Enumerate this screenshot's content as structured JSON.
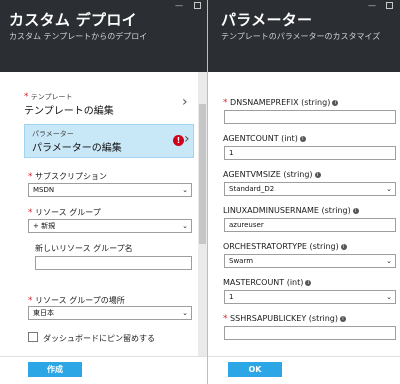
{
  "left_blade": {
    "title": "カスタム デプロイ",
    "subtitle": "カスタム テンプレートからのデプロイ",
    "template": {
      "required_mark": "*",
      "label": "テンプレート",
      "value": "テンプレートの編集"
    },
    "parameters": {
      "label": "パラメーター",
      "value": "パラメーターの編集",
      "error_icon": "!"
    },
    "subscription": {
      "required_mark": "*",
      "label": "サブスクリプション",
      "value": "MSDN"
    },
    "resource_group": {
      "required_mark": "*",
      "label": "リソース グループ",
      "value": "+ 新規"
    },
    "new_resource_group": {
      "label": "新しいリソース グループ名",
      "value": ""
    },
    "resource_group_location": {
      "required_mark": "*",
      "label": "リソース グループの場所",
      "value": "東日本"
    },
    "pin_to_dashboard": {
      "label": "ダッシュボードにピン留めする",
      "checked": false
    },
    "create_button": "作成"
  },
  "right_blade": {
    "title": "パラメーター",
    "subtitle": "テンプレートのパラメーターのカスタマイズ",
    "fields": [
      {
        "required_mark": "*",
        "label": "DNSNAMEPREFIX (string)",
        "info_icon": "i",
        "value": ""
      },
      {
        "required_mark": "",
        "label": "AGENTCOUNT (int)",
        "info_icon": "i",
        "value": "1"
      },
      {
        "required_mark": "",
        "label": "AGENTVMSIZE (string)",
        "info_icon": "i",
        "value": "Standard_D2"
      },
      {
        "required_mark": "",
        "label": "LINUXADMINUSERNAME (string)",
        "info_icon": "i",
        "value": "azureuser"
      },
      {
        "required_mark": "",
        "label": "ORCHESTRATORTYPE (string)",
        "info_icon": "i",
        "value": "Swarm"
      },
      {
        "required_mark": "",
        "label": "MASTERCOUNT (int)",
        "info_icon": "i",
        "value": "1"
      },
      {
        "required_mark": "*",
        "label": "SSHRSAPUBLICKEY (string)",
        "info_icon": "i",
        "value": ""
      }
    ],
    "ok_button": "OK"
  },
  "window_controls": {
    "minimize": "—",
    "maximize": "□"
  },
  "icons": {
    "chevron": "chevron-right-icon",
    "select_arrow": "chevron-down-icon",
    "info": "info-icon",
    "error": "error-icon"
  },
  "colors": {
    "header_bg": "#2b2f34",
    "selected_bg": "#c9e8f7",
    "button_bg": "#2da6e6",
    "required": "#d9232e",
    "error": "#d0021b"
  }
}
